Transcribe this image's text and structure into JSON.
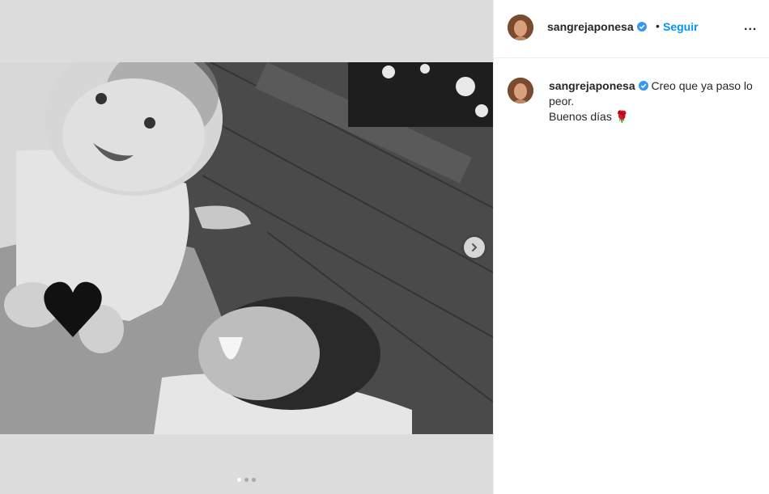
{
  "post": {
    "username": "sangrejaponesa",
    "separator": "•",
    "follow_label": "Seguir",
    "more_label": "...",
    "caption_line1": "Creo que ya paso lo peor.",
    "caption_line2": "Buenos días",
    "caption_emoji": "🌹",
    "heart_emoji": "🖤",
    "carousel": {
      "total": 3,
      "current": 1
    }
  },
  "colors": {
    "accent": "#0095f6",
    "verified": "#3897f0",
    "text": "#262626",
    "media_bg": "#dcdcdc"
  },
  "icons": {
    "verified": "verified-badge-icon",
    "next": "chevron-right-icon",
    "more": "more-options-icon"
  }
}
